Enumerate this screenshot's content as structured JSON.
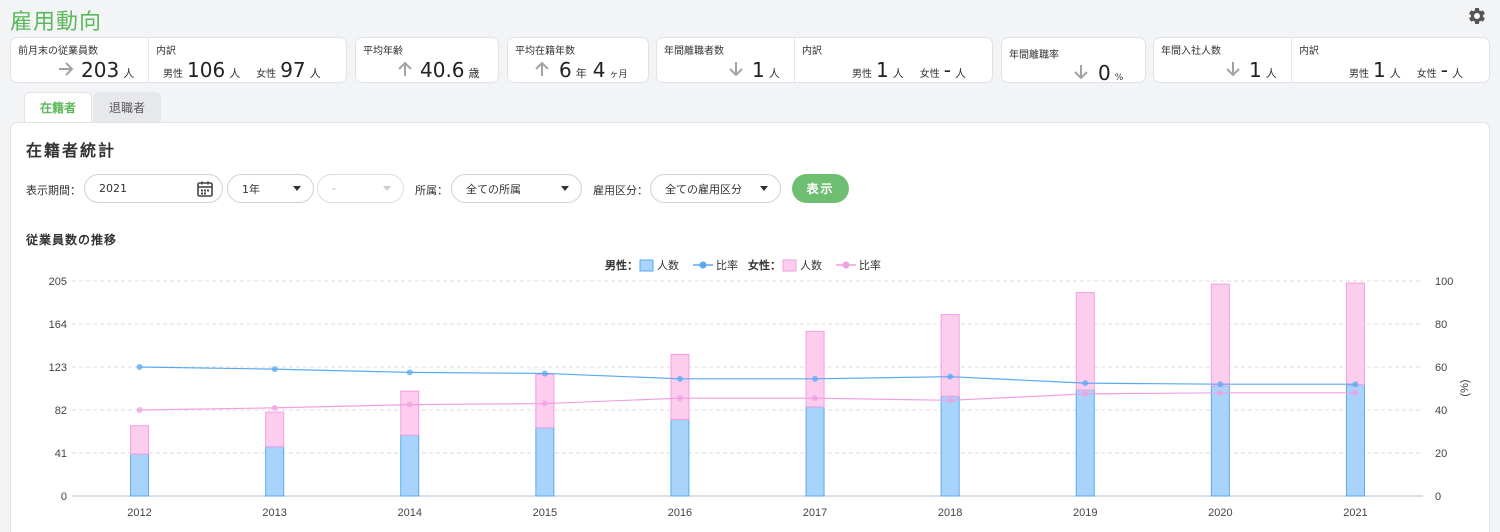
{
  "page": {
    "title": "雇用動向"
  },
  "summary": {
    "employees": {
      "label": "前月末の従業員数",
      "value": "203",
      "unit": "人",
      "trend": "right"
    },
    "breakdown1": {
      "label": "内訳",
      "male_label": "男性",
      "male_value": "106",
      "male_unit": "人",
      "female_label": "女性",
      "female_value": "97",
      "female_unit": "人"
    },
    "avg_age": {
      "label": "平均年齢",
      "value": "40.6",
      "unit": "歳",
      "trend": "up"
    },
    "avg_tenure": {
      "label": "平均在籍年数",
      "years": "6",
      "years_unit": "年",
      "months": "4",
      "months_unit": "ヶ月",
      "trend": "up"
    },
    "leavers": {
      "label": "年間離職者数",
      "value": "1",
      "unit": "人",
      "trend": "down"
    },
    "breakdown2": {
      "label": "内訳",
      "male_label": "男性",
      "male_value": "1",
      "male_unit": "人",
      "female_label": "女性",
      "female_value": "-",
      "female_unit": "人"
    },
    "turnover": {
      "label": "年間離職率",
      "value": "0",
      "unit": "%",
      "trend": "down"
    },
    "hires": {
      "label": "年間入社人数",
      "value": "1",
      "unit": "人",
      "trend": "down"
    },
    "breakdown3": {
      "label": "内訳",
      "male_label": "男性",
      "male_value": "1",
      "male_unit": "人",
      "female_label": "女性",
      "female_value": "-",
      "female_unit": "人"
    }
  },
  "tabs": [
    {
      "label": "在籍者",
      "active": true
    },
    {
      "label": "退職者",
      "active": false
    }
  ],
  "panel": {
    "title": "在籍者統計",
    "chart_title": "従業員数の推移"
  },
  "filters": {
    "period_label": "表示期間：",
    "period_value": "2021",
    "span_value": "1年",
    "sub_value": "-",
    "dept_label": "所属：",
    "dept_value": "全ての所属",
    "emp_label": "雇用区分：",
    "emp_value": "全ての雇用区分",
    "show_button": "表示"
  },
  "colors": {
    "accent": "#5cb85c",
    "male_bar": "#a8d4fb",
    "male_line": "#5aa9f0",
    "female_bar": "#fdcdee",
    "female_line": "#f29fe2"
  },
  "icons": {
    "settings": "gear-icon",
    "calendar": "calendar-icon"
  },
  "chart_data": {
    "type": "bar",
    "x": [
      "2012",
      "2013",
      "2014",
      "2015",
      "2016",
      "2017",
      "2018",
      "2019",
      "2020",
      "2021"
    ],
    "legend": {
      "male_group": "男性：",
      "female_group": "女性：",
      "count": "人数",
      "ratio": "比率"
    },
    "series": [
      {
        "name": "男性 人数",
        "kind": "bar",
        "axis": "left",
        "values": [
          40,
          47,
          58,
          65,
          73,
          85,
          95,
          101,
          105,
          106
        ]
      },
      {
        "name": "女性 人数",
        "kind": "bar",
        "axis": "left",
        "values": [
          27,
          33,
          42,
          51,
          62,
          72,
          78,
          93,
          97,
          97
        ]
      },
      {
        "name": "男性 比率",
        "kind": "line",
        "axis": "right",
        "values": [
          60,
          59,
          57.5,
          57,
          54.5,
          54.5,
          55.5,
          52.5,
          52,
          52
        ]
      },
      {
        "name": "女性 比率",
        "kind": "line",
        "axis": "right",
        "values": [
          40,
          41,
          42.5,
          43,
          45.5,
          45.5,
          44.5,
          47.5,
          48,
          48
        ]
      }
    ],
    "y_left": {
      "ticks": [
        "0",
        "41",
        "82",
        "123",
        "164",
        "205"
      ],
      "range": [
        0,
        205
      ]
    },
    "y_right": {
      "ticks": [
        "0",
        "20",
        "40",
        "60",
        "80",
        "100"
      ],
      "range": [
        0,
        100
      ],
      "label": "(%)"
    },
    "stacked": true,
    "grid": true,
    "legend_position": "top-center"
  }
}
